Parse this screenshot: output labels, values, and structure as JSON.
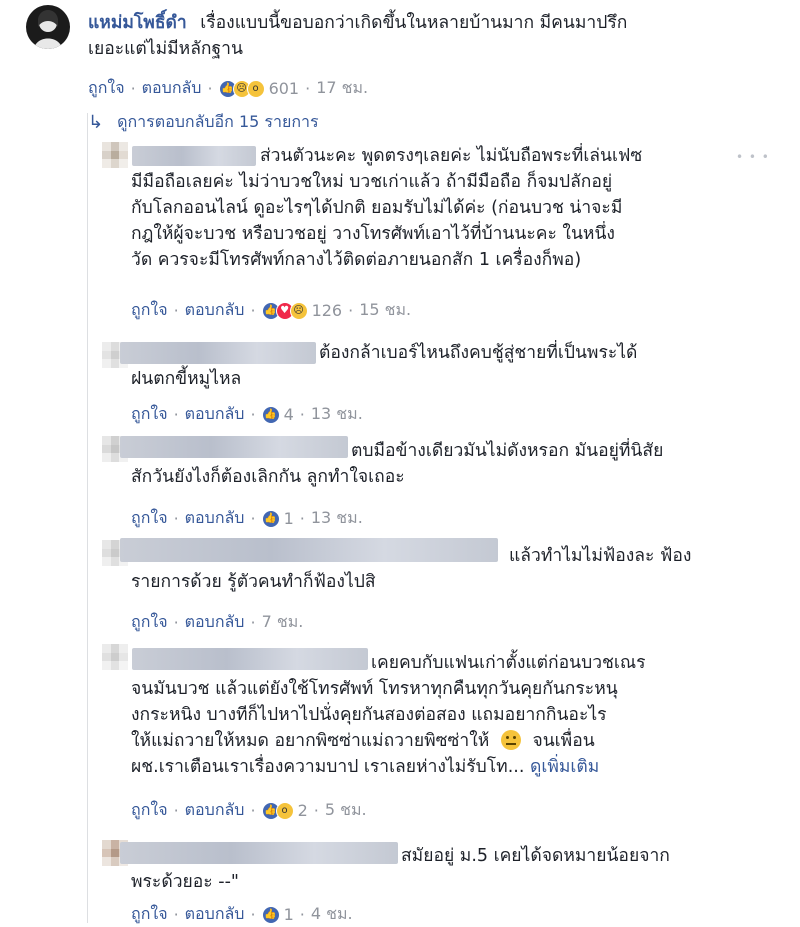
{
  "top_comment": {
    "author": "แหม่มโพธิ์ดำ",
    "text_line1": "เรื่องแบบนี้ขอบอกว่าเกิดขึ้นในหลายบ้านมาก มีคนมาปรึก",
    "text_line2": "เยอะแต่ไม่มีหลักฐาน",
    "like_label": "ถูกใจ",
    "reply_label": "ตอบกลับ",
    "reaction_count": "601",
    "time": "17 ชม."
  },
  "view_replies": "ดูการตอบกลับอีก 15 รายการ",
  "replies": [
    {
      "lines": [
        "ส่วนตัวนะคะ พูดตรงๆเลยค่ะ ไม่นับถือพระที่เล่นเฟซ",
        "มีมือถือเลยค่ะ ไม่ว่าบวชใหม่ บวชเก่าแล้ว ถ้ามีมือถือ ก็จมปลักอยู่",
        "กับโลกออนไลน์ ดูอะไรๆได้ปกติ ยอมรับไม่ได้ค่ะ (ก่อนบวช น่าจะมี",
        "กฎให้ผู้จะบวช หรือบวชอยู่ วางโทรศัพท์เอาไว้ที่บ้านนะคะ ในหนึ่ง",
        "วัด ควรจะมีโทรศัพท์กลางไว้ติดต่อภายนอกสัก 1 เครื่องก็พอ)"
      ],
      "like_label": "ถูกใจ",
      "reply_label": "ตอบกลับ",
      "count": "126",
      "time": "15 ชม."
    },
    {
      "lines": [
        "ต้องกล้าเบอร์ไหนถึงคบชู้สู่ชายที่เป็นพระได้",
        "ฝนตกขี้หมูไหล"
      ],
      "like_label": "ถูกใจ",
      "reply_label": "ตอบกลับ",
      "count": "4",
      "time": "13 ชม."
    },
    {
      "lines": [
        "ตบมือข้างเดียวมันไม่ดังหรอก มันอยู่ที่นิสัย",
        "สักวันยังไงก็ต้องเลิกกัน ลูกทำใจเถอะ"
      ],
      "like_label": "ถูกใจ",
      "reply_label": "ตอบกลับ",
      "count": "1",
      "time": "13 ชม."
    },
    {
      "lines": [
        "แล้วทำไมไม่ฟ้องละ ฟ้อง",
        "รายการด้วย รู้ตัวคนทำก็ฟ้องไปสิ"
      ],
      "like_label": "ถูกใจ",
      "reply_label": "ตอบกลับ",
      "time": "7 ชม."
    },
    {
      "lines": [
        "เคยคบกับแฟนเก่าตั้งแต่ก่อนบวชเณร",
        "จนมันบวช แล้วแต่ยังใช้โทรศัพท์ โทรหาทุกคืนทุกวันคุยกันกระหนุ",
        "งกระหนิง บางทีก็ไปหาไปนั่งคุยกันสองต่อสอง แถมอยากกินอะไร",
        "ให้แม่ถวายให้หมด อยากพิซซ่าแม่ถวายพิซซ่าให้",
        "จนเพื่อน",
        "ผช.เราเตือนเราเรื่องความบาป เราเลยห่างไม่รับโท..."
      ],
      "see_more": "ดูเพิ่มเติม",
      "like_label": "ถูกใจ",
      "reply_label": "ตอบกลับ",
      "count": "2",
      "time": "5 ชม."
    },
    {
      "lines": [
        "สมัยอยู่ ม.5 เคยได้จดหมายน้อยจาก",
        "พระด้วยอะ --\""
      ],
      "like_label": "ถูกใจ",
      "reply_label": "ตอบกลับ",
      "count": "1",
      "time": "4 ชม."
    }
  ],
  "colors": {
    "link": "#365899",
    "meta_gray": "#90949c",
    "like_blue": "#4267b2",
    "text": "#1d2129"
  }
}
